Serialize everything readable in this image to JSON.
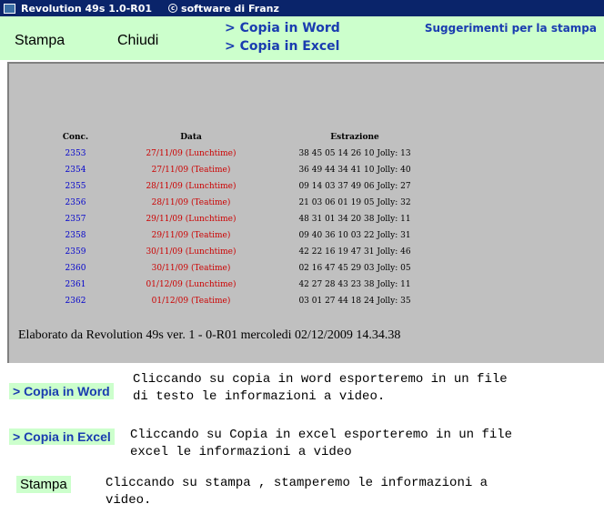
{
  "titlebar": {
    "app_title": "Revolution 49s 1.0-R01",
    "author": "software di Franz"
  },
  "toolbar": {
    "stampa": "Stampa",
    "chiudi": "Chiudi",
    "copia_word": "> Copia in Word",
    "copia_excel": "> Copia in Excel",
    "suggerimenti": "Suggerimenti per la stampa"
  },
  "report": {
    "headers": {
      "conc": "Conc.",
      "data": "Data",
      "estrazione": "Estrazione"
    },
    "rows": [
      {
        "conc": "2353",
        "data": "27/11/09 (Lunchtime)",
        "estrazione": "38 45 05 14 26 10 Jolly: 13"
      },
      {
        "conc": "2354",
        "data": "27/11/09 (Teatime)",
        "estrazione": "36 49 44 34 41 10 Jolly: 40"
      },
      {
        "conc": "2355",
        "data": "28/11/09 (Lunchtime)",
        "estrazione": "09 14 03 37 49 06 Jolly: 27"
      },
      {
        "conc": "2356",
        "data": "28/11/09 (Teatime)",
        "estrazione": "21 03 06 01 19 05 Jolly: 32"
      },
      {
        "conc": "2357",
        "data": "29/11/09 (Lunchtime)",
        "estrazione": "48 31 01 34 20 38 Jolly: 11"
      },
      {
        "conc": "2358",
        "data": "29/11/09 (Teatime)",
        "estrazione": "09 40 36 10 03 22 Jolly: 31"
      },
      {
        "conc": "2359",
        "data": "30/11/09 (Lunchtime)",
        "estrazione": "42 22 16 19 47 31 Jolly: 46"
      },
      {
        "conc": "2360",
        "data": "30/11/09 (Teatime)",
        "estrazione": "02 16 47 45 29 03 Jolly: 05"
      },
      {
        "conc": "2361",
        "data": "01/12/09 (Lunchtime)",
        "estrazione": "42 27 28 43 23 38 Jolly: 11"
      },
      {
        "conc": "2362",
        "data": "01/12/09 (Teatime)",
        "estrazione": "03 01 27 44 18 24 Jolly: 35"
      }
    ],
    "footer": "Elaborato da Revolution 49s ver. 1 - 0-R01 mercoledi 02/12/2009 14.34.38"
  },
  "legend": {
    "word": {
      "label": "> Copia in Word",
      "line1": "Cliccando su copia in word esporteremo in un file",
      "line2": "di testo le informazioni a video."
    },
    "excel": {
      "label": "> Copia in Excel",
      "line1": "Cliccando su Copia in excel esporteremo in un file",
      "line2": "excel le informazioni a video"
    },
    "stampa": {
      "label": "Stampa",
      "line1": "Cliccando su stampa , stamperemo le informazioni a",
      "line2": "video."
    }
  },
  "colors": {
    "titlebar_bg": "#0a246a",
    "toolbar_bg": "#ccffcc",
    "report_bg": "#c0c0c0",
    "link_blue": "#1a3cb0",
    "conc_blue": "#0000cc",
    "date_red": "#cc0000"
  }
}
